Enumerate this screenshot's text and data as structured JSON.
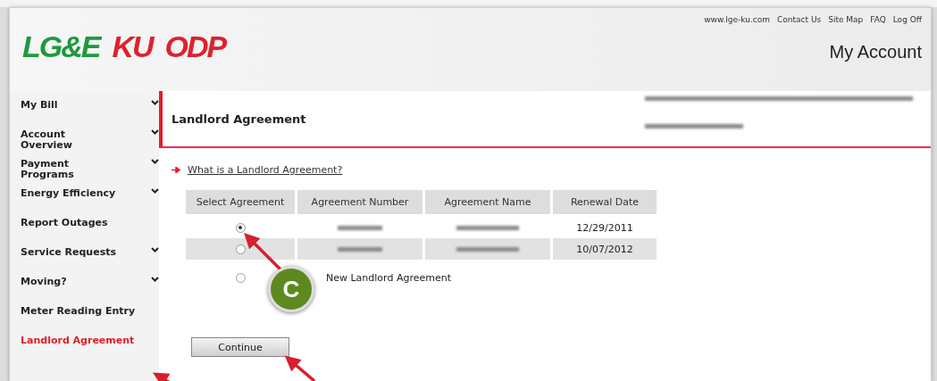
{
  "header": {
    "links": [
      "www.lge-ku.com",
      "Contact Us",
      "Site Map",
      "FAQ",
      "Log Off"
    ],
    "logos": [
      {
        "text": "LG&E",
        "color": "#1e9a3c"
      },
      {
        "text": "KU",
        "color": "#e0202e"
      },
      {
        "text": "ODP",
        "color": "#e0202e"
      }
    ],
    "title": "My Account"
  },
  "sidebar": {
    "items": [
      {
        "label": "My Bill",
        "expandable": true,
        "selected": false
      },
      {
        "label": "Account\nOverview",
        "expandable": true,
        "selected": false
      },
      {
        "label": "Payment\nPrograms",
        "expandable": true,
        "selected": false
      },
      {
        "label": "Energy Efficiency",
        "expandable": true,
        "selected": false
      },
      {
        "label": "Report Outages",
        "expandable": false,
        "selected": false
      },
      {
        "label": "Service Requests",
        "expandable": true,
        "selected": false
      },
      {
        "label": "Moving?",
        "expandable": true,
        "selected": false
      },
      {
        "label": "Meter Reading Entry",
        "expandable": false,
        "selected": false
      },
      {
        "label": "Landlord Agreement",
        "expandable": false,
        "selected": true
      }
    ]
  },
  "content": {
    "title": "Landlord Agreement",
    "help_link": "What is a Landlord Agreement?",
    "table": {
      "columns": [
        "Select Agreement",
        "Agreement Number",
        "Agreement Name",
        "Renewal Date"
      ],
      "rows": [
        {
          "selected": true,
          "renewal_date": "12/29/2011"
        },
        {
          "selected": false,
          "renewal_date": "10/07/2012"
        }
      ],
      "new_option": {
        "label": "New Landlord Agreement",
        "selected": false
      }
    },
    "continue_button": "Continue"
  },
  "annotation": {
    "badge": "C"
  }
}
